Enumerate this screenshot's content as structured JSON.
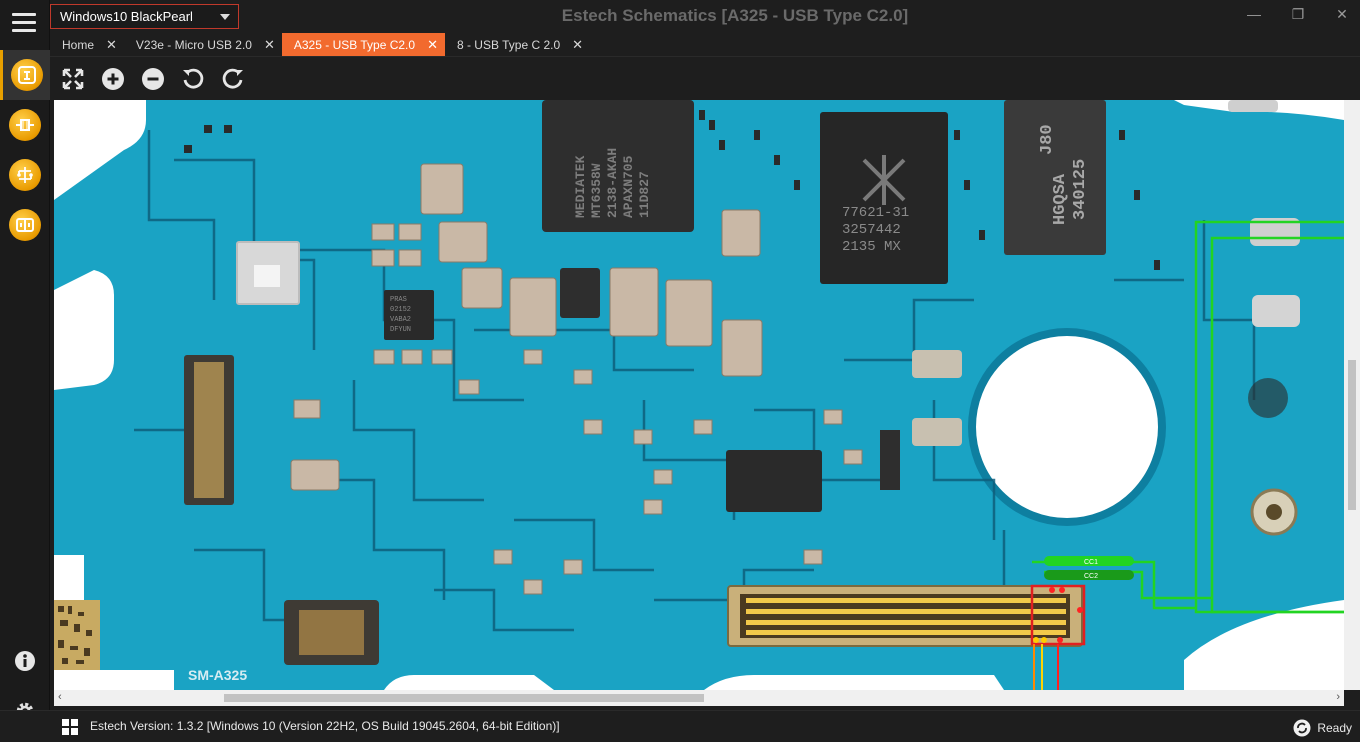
{
  "app": {
    "title": "Estech Schematics [A325 - USB Type C2.0]",
    "profile": "Windows10 BlackPearl"
  },
  "window_controls": {
    "minimize": "—",
    "maximize": "❐",
    "close": "✕"
  },
  "tabs": [
    {
      "label": "Home",
      "close": "✕",
      "active": false
    },
    {
      "label": "V23e - Micro USB 2.0",
      "close": "✕",
      "active": false
    },
    {
      "label": "A325 - USB Type C2.0",
      "close": "✕",
      "active": true
    },
    {
      "label": "8 - USB Type C 2.0",
      "close": "✕",
      "active": false
    }
  ],
  "toolbar": {
    "icons": [
      "fit-screen-icon",
      "zoom-in-icon",
      "zoom-out-icon",
      "rotate-left-icon",
      "rotate-right-icon"
    ]
  },
  "sidebar": {
    "icons": [
      "menu-icon",
      "schematics-icon",
      "components-icon",
      "circuit-icon",
      "boards-icon",
      "info-icon",
      "settings-icon"
    ]
  },
  "board": {
    "chips": {
      "mediatek": [
        "MEDIATEK",
        "MT6358W",
        "2138-AKAH",
        "APAXN705",
        "11D827"
      ],
      "pa": [
        "77621-31",
        "3257442",
        "2135   MX"
      ],
      "mem": [
        "J80",
        "HGQSA",
        "340125"
      ],
      "pmic": [
        "PRAS",
        "02152",
        "VABA2",
        "DFYUN"
      ]
    },
    "silk_label": "SM-A325",
    "net_labels": [
      "CC1",
      "CC2"
    ],
    "colors": {
      "pcb": "#1aa3c4",
      "trace": "#0e5f7c",
      "highlight": "#22d422",
      "ic": "#2b2b2b",
      "comp": "#c9b8a6"
    }
  },
  "status": {
    "text": "Estech Version: 1.3.2 [Windows 10 (Version 22H2, OS Build 19045.2604, 64-bit Edition)]",
    "ready": "Ready"
  },
  "colors": {
    "accent": "#f26a2e",
    "select_border": "#c0392b",
    "icon_orange": "#e99b00"
  }
}
